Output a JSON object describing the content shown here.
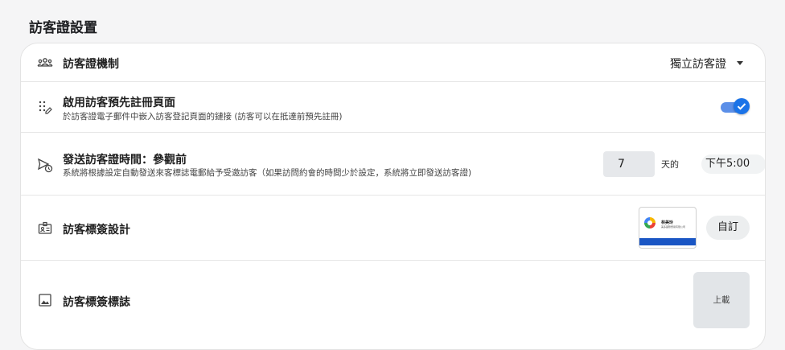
{
  "page": {
    "title": "訪客證設置"
  },
  "rows": {
    "mechanism": {
      "title": "訪客證機制",
      "value": "獨立訪客證",
      "icon": "people-group-icon"
    },
    "preregister": {
      "title": "啟用訪客預先註冊頁面",
      "subtitle": "於訪客證電子郵件中嵌入訪客登記頁面的鏈接 (訪客可以在抵達前預先註冊)",
      "enabled": true,
      "icon": "dots-edit-icon"
    },
    "send_time": {
      "title": "發送訪客證時間：參觀前",
      "subtitle": "系統將根據設定自動發送來客標誌電郵給予受邀訪客（如果訪問約會的時間少於設定，系統將立即發送訪客證)",
      "days_value": "7",
      "days_label": "天的",
      "time_value": "下午5:00",
      "icon": "send-clock-icon"
    },
    "badge_design": {
      "title": "訪客標簽設計",
      "button": "自訂",
      "icon": "badge-id-icon",
      "preview": {
        "name": "林美玲",
        "company": "美多國際貿易有限公司"
      }
    },
    "badge_logo": {
      "title": "訪客標簽標誌",
      "button": "上載",
      "icon": "image-icon"
    }
  },
  "colors": {
    "accent": "#1a73e8",
    "badge_bar": "#1a56c4"
  }
}
